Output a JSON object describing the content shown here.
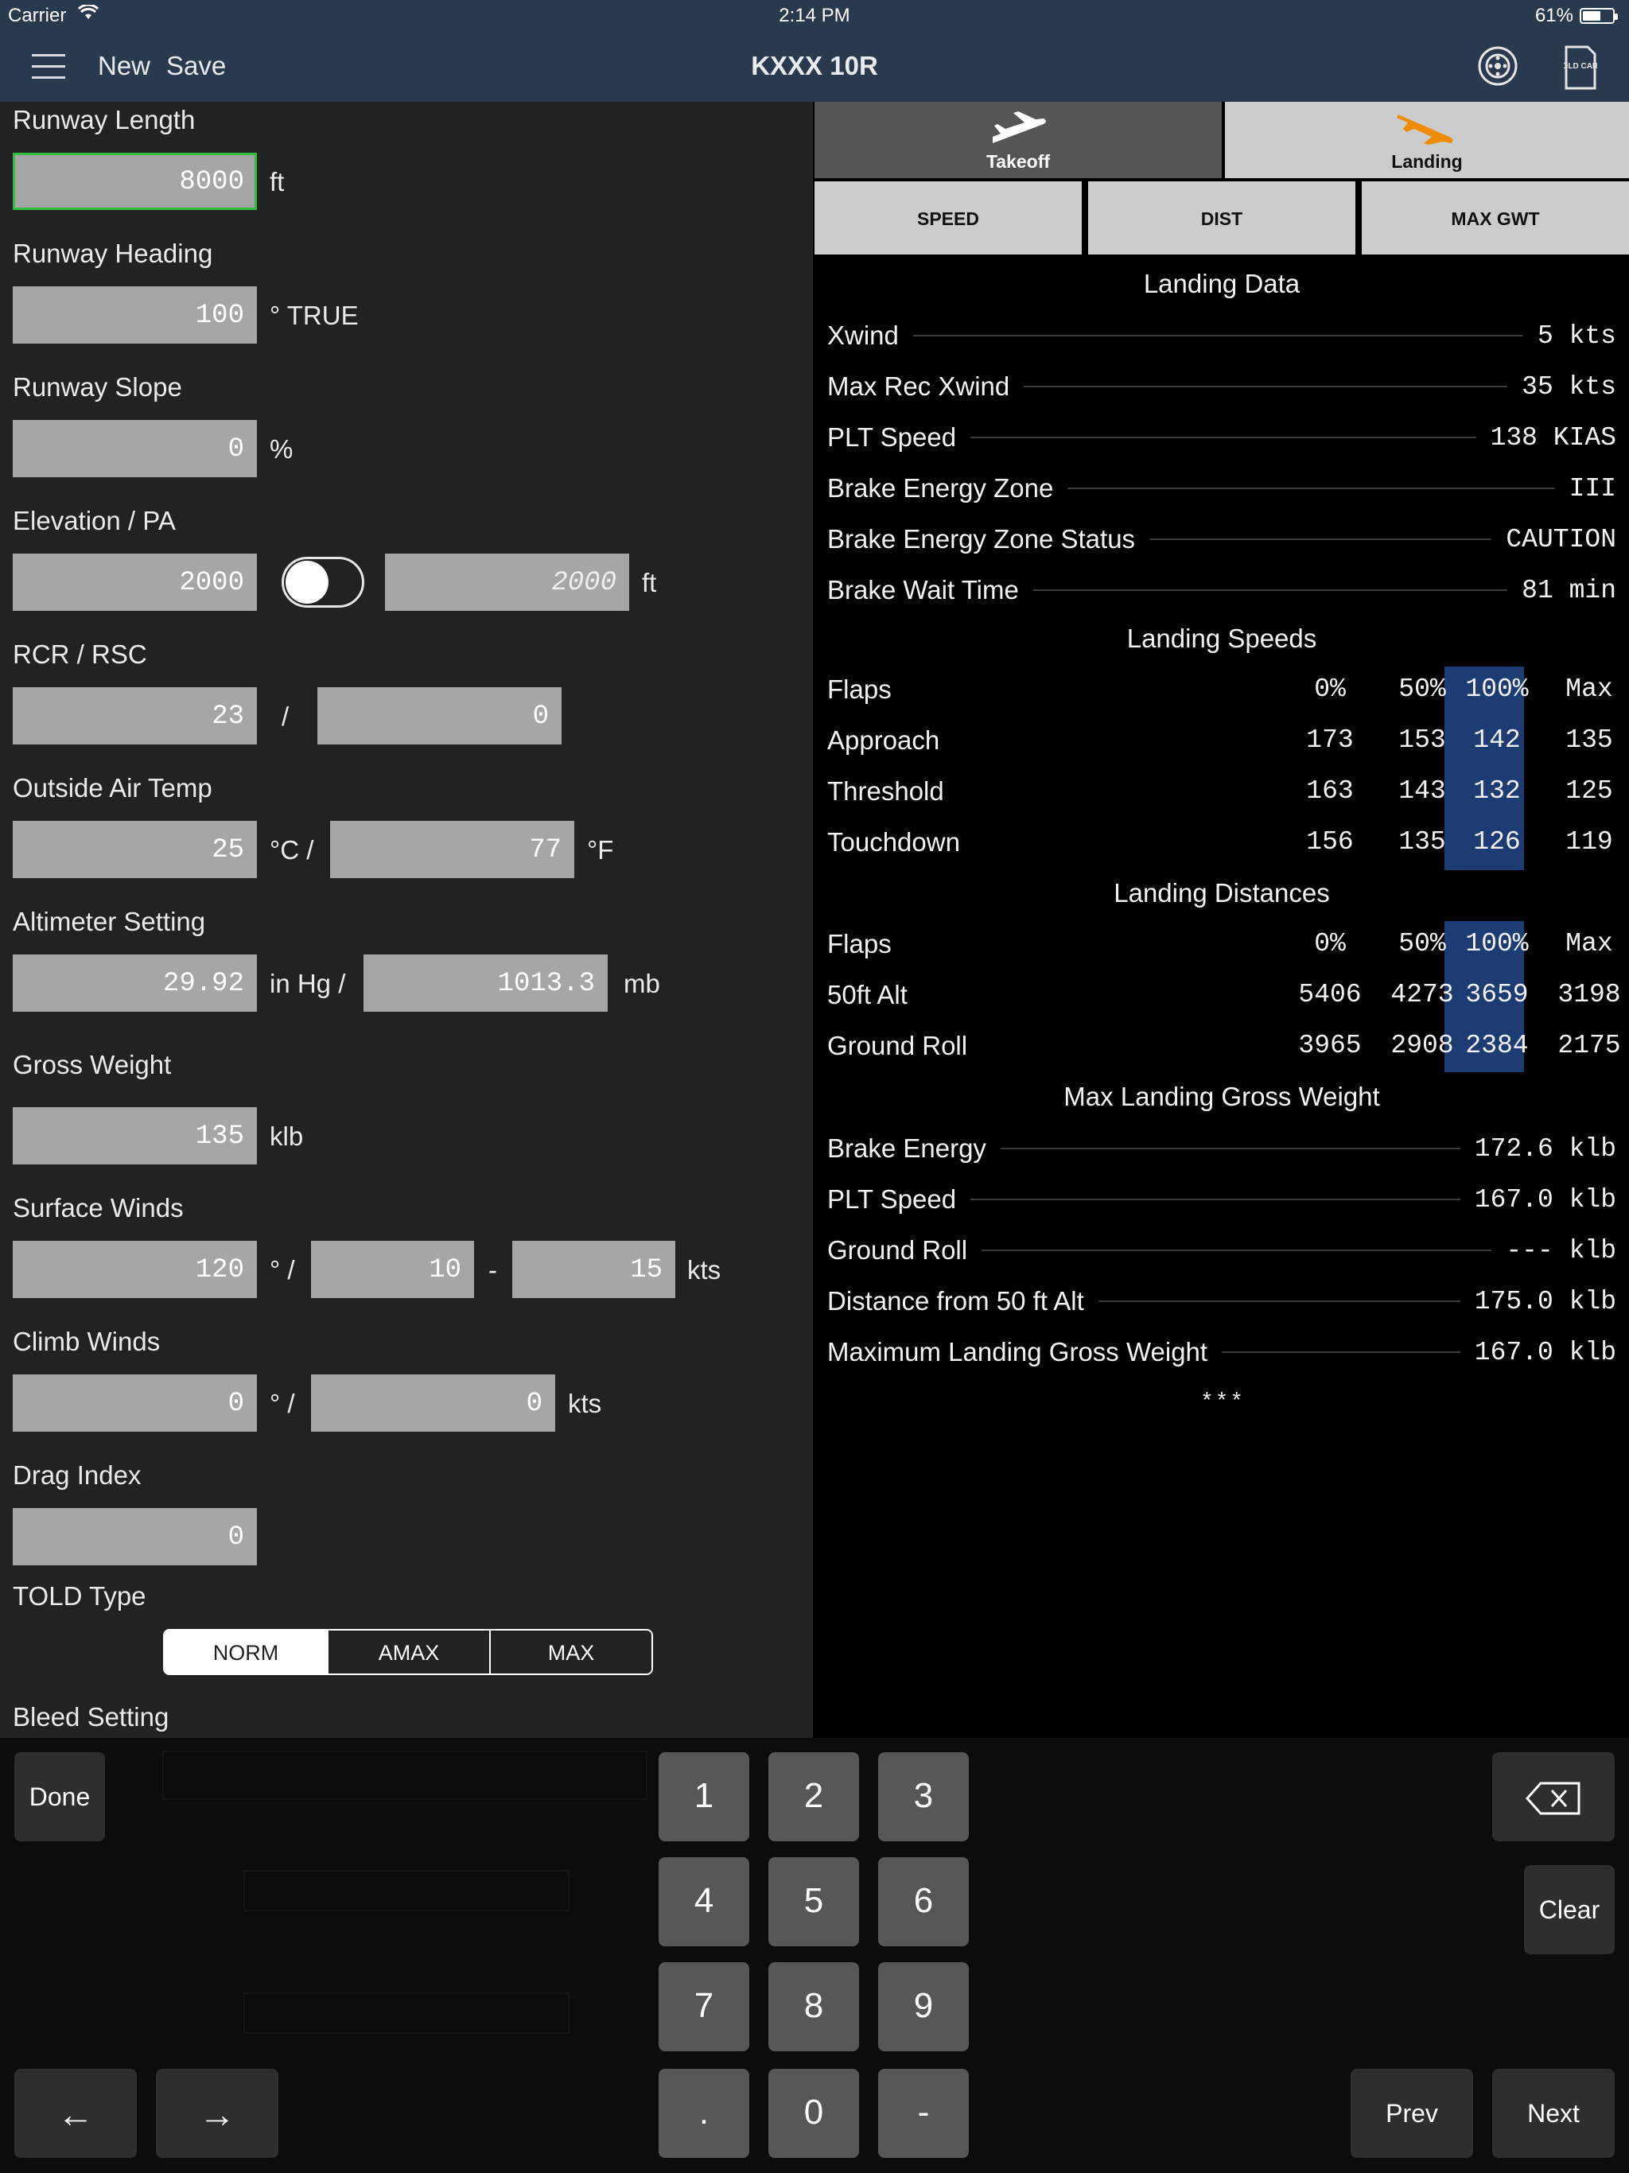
{
  "status_bar": {
    "carrier": "Carrier",
    "time": "2:14 PM",
    "battery": "61%",
    "battery_level": 0.61
  },
  "nav": {
    "new_label": "New",
    "save_label": "Save",
    "title": "KXXX 10R",
    "icons": [
      "menu-icon",
      "brake-disc-icon",
      "told-card-icon"
    ],
    "told_card_icon_text": "TOLD CARD"
  },
  "form": {
    "runway_length": {
      "label": "Runway Length",
      "value": "8000",
      "unit": "ft"
    },
    "runway_heading": {
      "label": "Runway Heading",
      "value": "100",
      "unit": "° TRUE"
    },
    "runway_slope": {
      "label": "Runway Slope",
      "value": "0",
      "unit": "%"
    },
    "elevation": {
      "label": "Elevation / PA",
      "value": "2000",
      "pa_value": "2000",
      "unit": "ft",
      "toggle_on": false
    },
    "rcr": {
      "label": "RCR / RSC",
      "rcr_value": "23",
      "sep": "/",
      "rsc_value": "0"
    },
    "oat": {
      "label": "Outside Air Temp",
      "c_value": "25",
      "c_unit": "°C /",
      "f_value": "77",
      "f_unit": "°F"
    },
    "altimeter": {
      "label": "Altimeter Setting",
      "inhg_value": "29.92",
      "inhg_unit": "in Hg /",
      "mb_value": "1013.3",
      "mb_unit": "mb"
    },
    "gross_weight": {
      "label": "Gross Weight",
      "value": "135",
      "unit": "klb"
    },
    "surface_winds": {
      "label": "Surface Winds",
      "dir": "120",
      "dir_unit": "° /",
      "speed": "10",
      "dash": "-",
      "gust": "15",
      "unit": "kts"
    },
    "climb_winds": {
      "label": "Climb Winds",
      "dir": "0",
      "dir_unit": "° /",
      "speed": "0",
      "unit": "kts"
    },
    "drag_index": {
      "label": "Drag Index",
      "value": "0"
    },
    "told_type": {
      "label": "TOLD Type",
      "options": [
        "NORM",
        "AMAX",
        "MAX"
      ],
      "selected": "NORM"
    },
    "bleed_setting": {
      "label": "Bleed Setting"
    }
  },
  "tabs": {
    "takeoff": "Takeoff",
    "landing": "Landing",
    "active": "Landing",
    "sub": [
      "SPEED",
      "DIST",
      "MAX GWT"
    ]
  },
  "landing_data": {
    "title": "Landing Data",
    "rows": [
      {
        "k": "Xwind",
        "v": "5 kts"
      },
      {
        "k": "Max Rec Xwind",
        "v": "35 kts"
      },
      {
        "k": "PLT Speed",
        "v": "138 KIAS"
      },
      {
        "k": "Brake Energy Zone",
        "v": "III "
      },
      {
        "k": "Brake Energy Zone Status",
        "v": "CAUTION "
      },
      {
        "k": "Brake Wait Time",
        "v": "81 min"
      }
    ]
  },
  "landing_speeds": {
    "title": "Landing Speeds",
    "header": {
      "k": "Flaps",
      "c": [
        "0%",
        "50%",
        "100%",
        "Max"
      ]
    },
    "rows": [
      {
        "k": "Approach",
        "c": [
          "173",
          "153",
          "142",
          "135"
        ]
      },
      {
        "k": "Threshold",
        "c": [
          "163",
          "143",
          "132",
          "125"
        ]
      },
      {
        "k": "Touchdown",
        "c": [
          "156",
          "135",
          "126",
          "119"
        ]
      }
    ]
  },
  "landing_distances": {
    "title": "Landing Distances",
    "header": {
      "k": "Flaps",
      "c": [
        "0%",
        "50%",
        "100%",
        "Max"
      ]
    },
    "rows": [
      {
        "k": "50ft Alt",
        "c": [
          "5406",
          "4273",
          "3659",
          "3198"
        ]
      },
      {
        "k": "Ground Roll",
        "c": [
          "3965",
          "2908",
          "2384",
          "2175"
        ]
      }
    ]
  },
  "max_landing_gw": {
    "title": "Max Landing Gross Weight",
    "rows": [
      {
        "k": "Brake Energy",
        "v": "172.6 klb"
      },
      {
        "k": "PLT Speed",
        "v": "167.0 klb"
      },
      {
        "k": "Ground Roll",
        "v": "--- klb"
      },
      {
        "k": "Distance from 50 ft Alt",
        "v": "175.0 klb"
      },
      {
        "k": "Maximum Landing Gross Weight",
        "v": "167.0 klb"
      }
    ],
    "footer": "* * *"
  },
  "keyboard": {
    "done": "Done",
    "clear": "Clear",
    "prev": "Prev",
    "next": "Next",
    "keys": [
      "1",
      "2",
      "3",
      "4",
      "5",
      "6",
      "7",
      "8",
      "9",
      ".",
      "0",
      "-"
    ],
    "left_arrow": "←",
    "right_arrow": "→"
  }
}
